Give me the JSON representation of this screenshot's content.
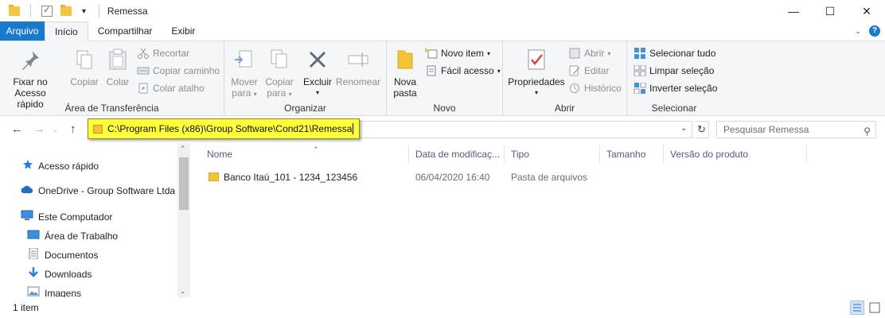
{
  "window": {
    "title": "Remessa",
    "minimize_glyph": "—",
    "maximize_glyph": "☐",
    "close_glyph": "✕"
  },
  "ribbon_tabs": [
    {
      "label": "Arquivo"
    },
    {
      "label": "Início"
    },
    {
      "label": "Compartilhar"
    },
    {
      "label": "Exibir"
    }
  ],
  "ribbon": {
    "clipboard": {
      "group_label": "Área de Transferência",
      "pin_label_1": "Fixar no",
      "pin_label_2": "Acesso rápido",
      "copy_label": "Copiar",
      "paste_label": "Colar",
      "cut_label": "Recortar",
      "copy_path_label": "Copiar caminho",
      "paste_shortcut_label": "Colar atalho"
    },
    "organize": {
      "group_label": "Organizar",
      "move_label_1": "Mover",
      "move_label_2": "para",
      "copyto_label_1": "Copiar",
      "copyto_label_2": "para",
      "delete_label": "Excluir",
      "rename_label": "Renomear"
    },
    "new": {
      "group_label": "Novo",
      "new_folder_label_1": "Nova",
      "new_folder_label_2": "pasta",
      "new_item_label": "Novo item",
      "easy_access_label": "Fácil acesso"
    },
    "open": {
      "group_label": "Abrir",
      "properties_label": "Propriedades",
      "open_label": "Abrir",
      "edit_label": "Editar",
      "history_label": "Histórico"
    },
    "select": {
      "group_label": "Selecionar",
      "select_all_label": "Selecionar tudo",
      "select_none_label": "Limpar seleção",
      "invert_label": "Inverter seleção"
    }
  },
  "address": {
    "path": "C:\\Program Files (x86)\\Group Software\\Cond21\\Remessa",
    "search_placeholder": "Pesquisar Remessa"
  },
  "nav_pane": {
    "items": [
      {
        "label": "Acesso rápido",
        "icon": "star-icon"
      },
      {
        "label": "OneDrive - Group Software Ltda",
        "icon": "cloud-icon"
      },
      {
        "label": "Este Computador",
        "icon": "computer-icon"
      },
      {
        "label": "Área de Trabalho",
        "icon": "desktop-icon"
      },
      {
        "label": "Documentos",
        "icon": "document-icon"
      },
      {
        "label": "Downloads",
        "icon": "download-icon"
      },
      {
        "label": "Imagens",
        "icon": "image-icon"
      }
    ]
  },
  "columns": [
    {
      "label": "Nome"
    },
    {
      "label": "Data de modificaç..."
    },
    {
      "label": "Tipo"
    },
    {
      "label": "Tamanho"
    },
    {
      "label": "Versão do produto"
    }
  ],
  "files": [
    {
      "name": "Banco Itaú_101 - 1234_123456",
      "modified": "06/04/2020 16:40",
      "type": "Pasta de arquivos",
      "size": "",
      "version": ""
    }
  ],
  "status": {
    "item_count": "1 item"
  },
  "colors": {
    "file_tab": "#1979ca",
    "highlight": "#ffff3d",
    "folder": "#f3c437"
  }
}
